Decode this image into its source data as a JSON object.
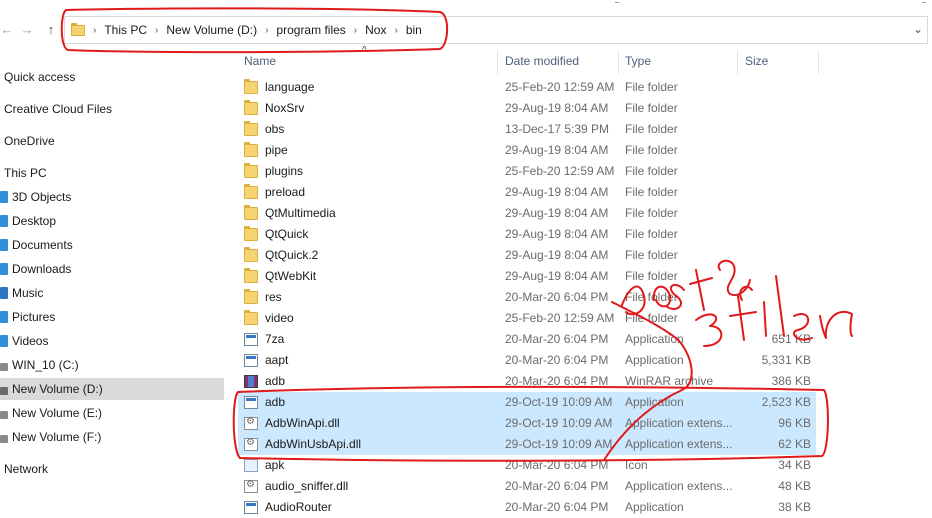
{
  "address": {
    "path": [
      "This PC",
      "New Volume (D:)",
      "program files",
      "Nox",
      "bin"
    ]
  },
  "icons": {
    "back": "arrow-left-icon",
    "forward": "arrow-right-icon",
    "up": "arrow-up-icon",
    "dropdown": "chevron-down-icon",
    "caret": "chevron-up-icon"
  },
  "nav": {
    "items": [
      {
        "label": "Quick access",
        "icon": ""
      },
      {
        "label": "Creative Cloud Files",
        "icon": ""
      },
      {
        "label": "OneDrive",
        "icon": ""
      },
      {
        "label": "This PC",
        "icon": ""
      },
      {
        "label": "3D Objects",
        "icon": "cube-icon"
      },
      {
        "label": "Desktop",
        "icon": "desktop-icon"
      },
      {
        "label": "Documents",
        "icon": "documents-icon"
      },
      {
        "label": "Downloads",
        "icon": "downloads-icon"
      },
      {
        "label": "Music",
        "icon": "music-icon"
      },
      {
        "label": "Pictures",
        "icon": "pictures-icon"
      },
      {
        "label": "Videos",
        "icon": "videos-icon"
      },
      {
        "label": "WIN_10 (C:)",
        "icon": "drive-icon"
      },
      {
        "label": "New Volume (D:)",
        "icon": "drive-icon",
        "selected": true
      },
      {
        "label": "New Volume (E:)",
        "icon": "drive-icon"
      },
      {
        "label": "New Volume (F:)",
        "icon": "drive-icon"
      },
      {
        "label": "Network",
        "icon": ""
      }
    ]
  },
  "columns": {
    "name": "Name",
    "date": "Date modified",
    "type": "Type",
    "size": "Size"
  },
  "files": [
    {
      "name": "language",
      "date": "25-Feb-20 12:59 AM",
      "type": "File folder",
      "size": "",
      "icon": "folder-icon"
    },
    {
      "name": "NoxSrv",
      "date": "29-Aug-19 8:04 AM",
      "type": "File folder",
      "size": "",
      "icon": "folder-icon"
    },
    {
      "name": "obs",
      "date": "13-Dec-17 5:39 PM",
      "type": "File folder",
      "size": "",
      "icon": "folder-icon"
    },
    {
      "name": "pipe",
      "date": "29-Aug-19 8:04 AM",
      "type": "File folder",
      "size": "",
      "icon": "folder-icon"
    },
    {
      "name": "plugins",
      "date": "25-Feb-20 12:59 AM",
      "type": "File folder",
      "size": "",
      "icon": "folder-icon"
    },
    {
      "name": "preload",
      "date": "29-Aug-19 8:04 AM",
      "type": "File folder",
      "size": "",
      "icon": "folder-icon"
    },
    {
      "name": "QtMultimedia",
      "date": "29-Aug-19 8:04 AM",
      "type": "File folder",
      "size": "",
      "icon": "folder-icon"
    },
    {
      "name": "QtQuick",
      "date": "29-Aug-19 8:04 AM",
      "type": "File folder",
      "size": "",
      "icon": "folder-icon"
    },
    {
      "name": "QtQuick.2",
      "date": "29-Aug-19 8:04 AM",
      "type": "File folder",
      "size": "",
      "icon": "folder-icon"
    },
    {
      "name": "QtWebKit",
      "date": "29-Aug-19 8:04 AM",
      "type": "File folder",
      "size": "",
      "icon": "folder-icon"
    },
    {
      "name": "res",
      "date": "20-Mar-20 6:04 PM",
      "type": "File folder",
      "size": "",
      "icon": "folder-icon"
    },
    {
      "name": "video",
      "date": "25-Feb-20 12:59 AM",
      "type": "File folder",
      "size": "",
      "icon": "folder-icon"
    },
    {
      "name": "7za",
      "date": "20-Mar-20 6:04 PM",
      "type": "Application",
      "size": "651 KB",
      "icon": "app-icon"
    },
    {
      "name": "aapt",
      "date": "20-Mar-20 6:04 PM",
      "type": "Application",
      "size": "5,331 KB",
      "icon": "app-icon"
    },
    {
      "name": "adb",
      "date": "20-Mar-20 6:04 PM",
      "type": "WinRAR archive",
      "size": "386 KB",
      "icon": "winrar-icon"
    },
    {
      "name": "adb",
      "date": "29-Oct-19 10:09 AM",
      "type": "Application",
      "size": "2,523 KB",
      "icon": "app-icon",
      "selected": true
    },
    {
      "name": "AdbWinApi.dll",
      "date": "29-Oct-19 10:09 AM",
      "type": "Application extens...",
      "size": "96 KB",
      "icon": "dll-icon",
      "selected": true
    },
    {
      "name": "AdbWinUsbApi.dll",
      "date": "29-Oct-19 10:09 AM",
      "type": "Application extens...",
      "size": "62 KB",
      "icon": "dll-icon",
      "selected": true
    },
    {
      "name": "apk",
      "date": "20-Mar-20 6:04 PM",
      "type": "Icon",
      "size": "34 KB",
      "icon": "image-icon"
    },
    {
      "name": "audio_sniffer.dll",
      "date": "20-Mar-20 6:04 PM",
      "type": "Application extens...",
      "size": "48 KB",
      "icon": "dll-icon"
    },
    {
      "name": "AudioRouter",
      "date": "20-Mar-20 6:04 PM",
      "type": "Application",
      "size": "38 KB",
      "icon": "app-icon"
    }
  ],
  "annotation": {
    "color": "#e0191b"
  },
  "colors": {
    "selection": "#cce8ff",
    "nav_selected": "#d9d9d9",
    "header_text": "#4c607a"
  }
}
